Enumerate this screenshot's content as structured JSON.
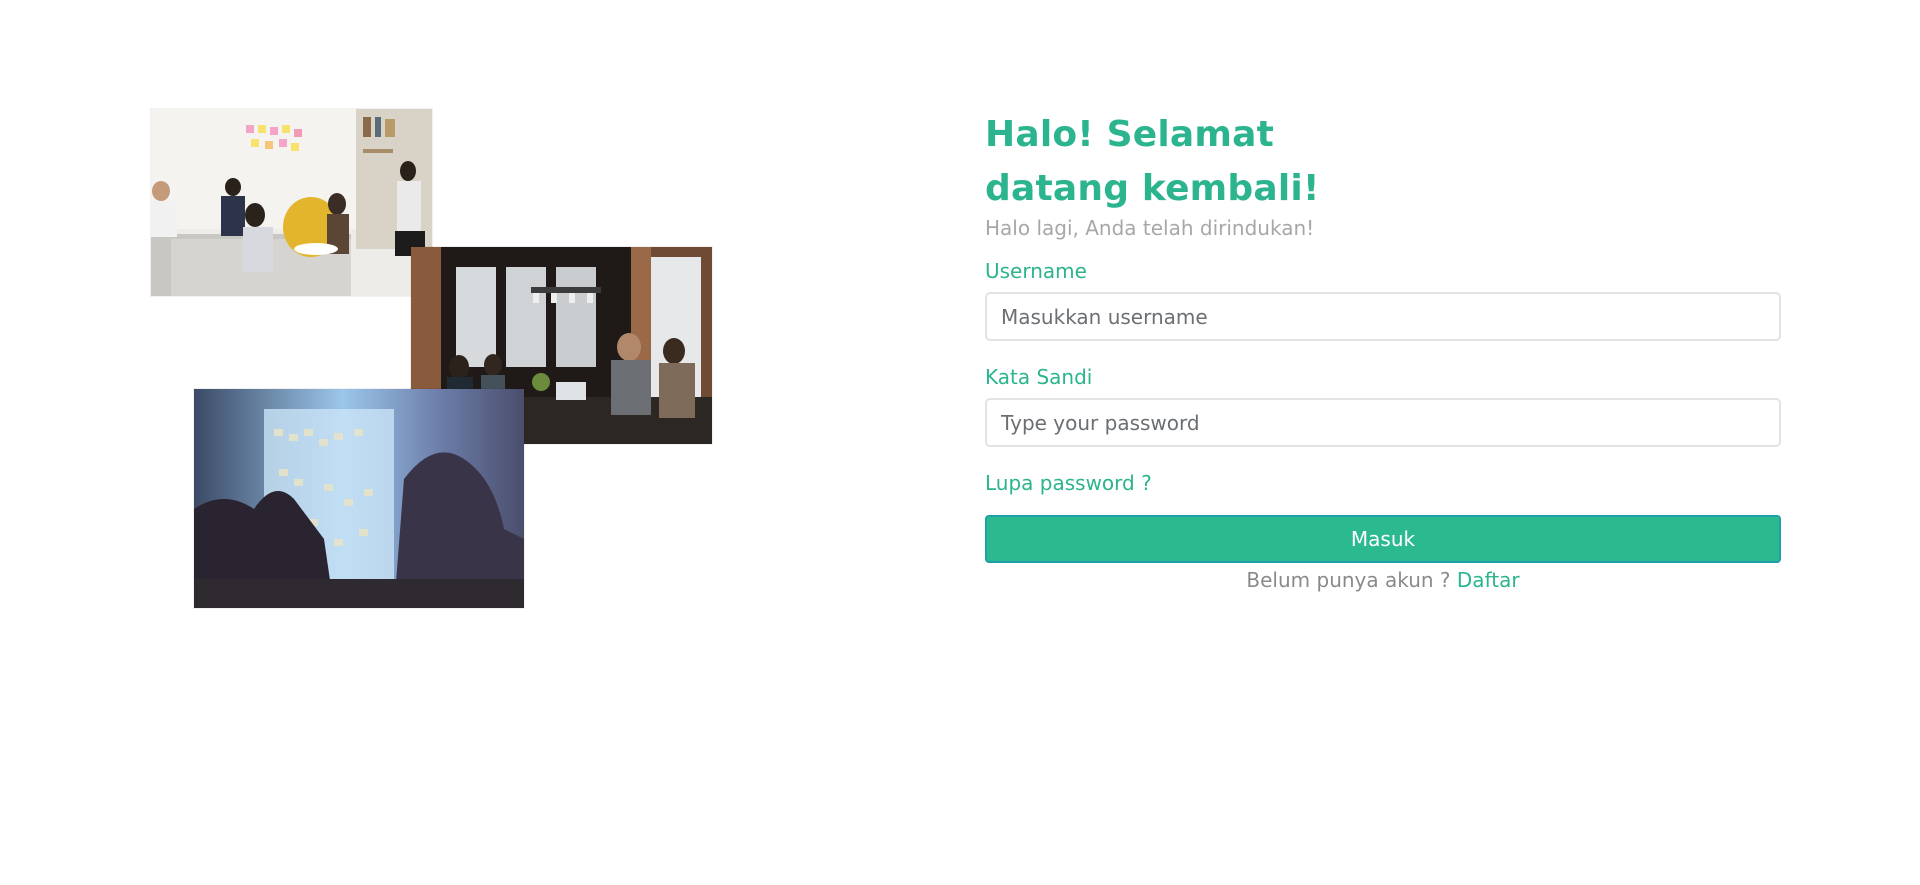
{
  "login": {
    "title": "Halo! Selamat datang kembali!",
    "subtitle": "Halo lagi, Anda telah dirindukan!",
    "username_label": "Username",
    "username_placeholder": "Masukkan username",
    "password_label": "Kata Sandi",
    "password_placeholder": "Type your password",
    "forgot_link": "Lupa password ?",
    "submit_label": "Masuk",
    "register_prompt": "Belum punya akun ?",
    "register_link": "Daftar"
  },
  "colors": {
    "accent": "#2bb48e",
    "muted_text": "#a7a7a7",
    "button_border": "#1fa0a8"
  },
  "photos": [
    {
      "subject": "office-meeting-photo"
    },
    {
      "subject": "team-working-table-photo"
    },
    {
      "subject": "whiteboard-planning-photo"
    }
  ]
}
